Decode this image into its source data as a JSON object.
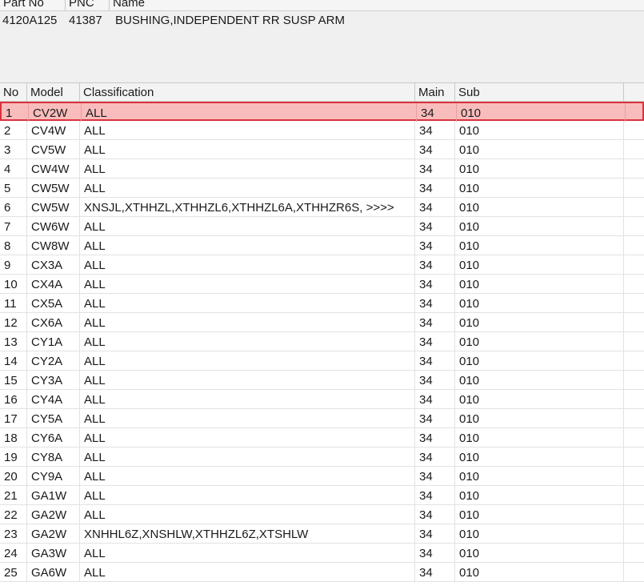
{
  "part_list": {
    "columns": [
      "Part No",
      "PNC",
      "Name"
    ],
    "rows": [
      {
        "part_no": "4120A125",
        "pnc": "41387",
        "name": "BUSHING,INDEPENDENT RR SUSP ARM"
      }
    ]
  },
  "model_grid": {
    "columns": [
      "No",
      "Model",
      "Classification",
      "Main",
      "Sub"
    ],
    "selected_index": 0,
    "selection_color": "#d8333c",
    "rows": [
      {
        "no": "1",
        "model": "CV2W",
        "classification": "ALL",
        "main": "34",
        "sub": "010"
      },
      {
        "no": "2",
        "model": "CV4W",
        "classification": "ALL",
        "main": "34",
        "sub": "010"
      },
      {
        "no": "3",
        "model": "CV5W",
        "classification": "ALL",
        "main": "34",
        "sub": "010"
      },
      {
        "no": "4",
        "model": "CW4W",
        "classification": "ALL",
        "main": "34",
        "sub": "010"
      },
      {
        "no": "5",
        "model": "CW5W",
        "classification": "ALL",
        "main": "34",
        "sub": "010"
      },
      {
        "no": "6",
        "model": "CW5W",
        "classification": "XNSJL,XTHHZL,XTHHZL6,XTHHZL6A,XTHHZR6S,  >>>>",
        "main": "34",
        "sub": "010"
      },
      {
        "no": "7",
        "model": "CW6W",
        "classification": "ALL",
        "main": "34",
        "sub": "010"
      },
      {
        "no": "8",
        "model": "CW8W",
        "classification": "ALL",
        "main": "34",
        "sub": "010"
      },
      {
        "no": "9",
        "model": "CX3A",
        "classification": "ALL",
        "main": "34",
        "sub": "010"
      },
      {
        "no": "10",
        "model": "CX4A",
        "classification": "ALL",
        "main": "34",
        "sub": "010"
      },
      {
        "no": "11",
        "model": "CX5A",
        "classification": "ALL",
        "main": "34",
        "sub": "010"
      },
      {
        "no": "12",
        "model": "CX6A",
        "classification": "ALL",
        "main": "34",
        "sub": "010"
      },
      {
        "no": "13",
        "model": "CY1A",
        "classification": "ALL",
        "main": "34",
        "sub": "010"
      },
      {
        "no": "14",
        "model": "CY2A",
        "classification": "ALL",
        "main": "34",
        "sub": "010"
      },
      {
        "no": "15",
        "model": "CY3A",
        "classification": "ALL",
        "main": "34",
        "sub": "010"
      },
      {
        "no": "16",
        "model": "CY4A",
        "classification": "ALL",
        "main": "34",
        "sub": "010"
      },
      {
        "no": "17",
        "model": "CY5A",
        "classification": "ALL",
        "main": "34",
        "sub": "010"
      },
      {
        "no": "18",
        "model": "CY6A",
        "classification": "ALL",
        "main": "34",
        "sub": "010"
      },
      {
        "no": "19",
        "model": "CY8A",
        "classification": "ALL",
        "main": "34",
        "sub": "010"
      },
      {
        "no": "20",
        "model": "CY9A",
        "classification": "ALL",
        "main": "34",
        "sub": "010"
      },
      {
        "no": "21",
        "model": "GA1W",
        "classification": "ALL",
        "main": "34",
        "sub": "010"
      },
      {
        "no": "22",
        "model": "GA2W",
        "classification": "ALL",
        "main": "34",
        "sub": "010"
      },
      {
        "no": "23",
        "model": "GA2W",
        "classification": "XNHHL6Z,XNSHLW,XTHHZL6Z,XTSHLW",
        "main": "34",
        "sub": "010"
      },
      {
        "no": "24",
        "model": "GA3W",
        "classification": "ALL",
        "main": "34",
        "sub": "010"
      },
      {
        "no": "25",
        "model": "GA6W",
        "classification": "ALL",
        "main": "34",
        "sub": "010"
      }
    ]
  }
}
